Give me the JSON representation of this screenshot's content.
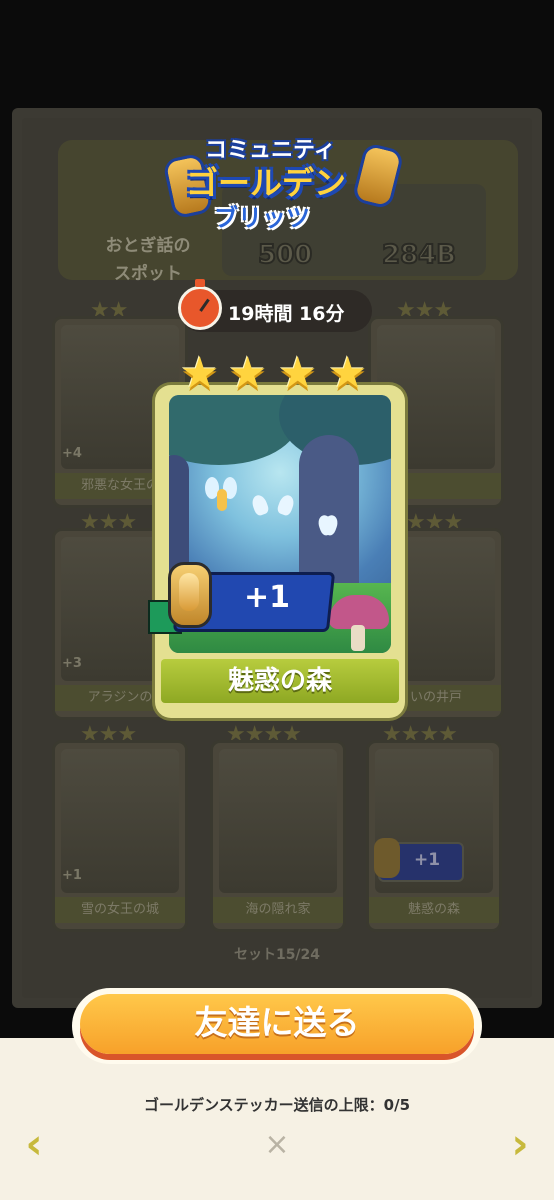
{
  "logo": {
    "line1": "コミュニティ",
    "line2": "ゴールデン",
    "line3": "ブリッツ"
  },
  "timer": {
    "text": "19時間 16分"
  },
  "background": {
    "spot_label": "おとぎ話の\nスポット",
    "count_a": "500",
    "count_b": "284B",
    "set_progress": "セット15/24",
    "cards": [
      {
        "name": "邪悪な女王の",
        "badge": "+4"
      },
      {
        "name": "アラジンの",
        "badge": "+3"
      },
      {
        "name": "雪の女王の城",
        "badge": "+1"
      },
      {
        "name": "海の隠れ家",
        "badge": ""
      },
      {
        "name": "魅惑の森",
        "badge": "+1"
      },
      {
        "name": "いの井戸",
        "badge": ""
      },
      {
        "name": "",
        "badge": ""
      }
    ]
  },
  "featured_card": {
    "name": "魅惑の森",
    "count_badge": "+1",
    "stars": 4
  },
  "send_button": {
    "label": "友達に送る"
  },
  "limit_text": "ゴールデンステッカー送信の上限：0/5",
  "nav": {
    "prev_icon": "chevron-left-icon",
    "next_icon": "chevron-right-icon",
    "close_icon": "close-icon"
  }
}
